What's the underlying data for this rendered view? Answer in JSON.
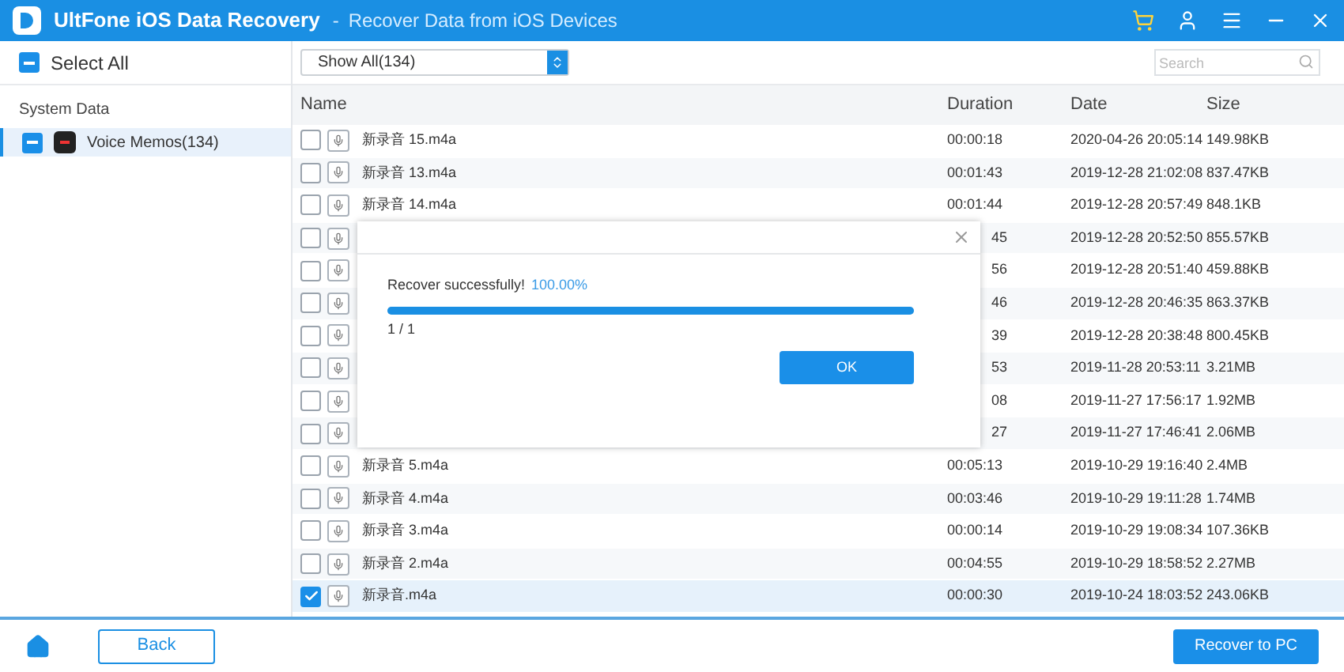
{
  "window": {
    "title": "UltFone iOS Data Recovery",
    "separator": "-",
    "subtitle": "Recover Data from iOS Devices"
  },
  "sidebar": {
    "select_all": {
      "label": "Select All",
      "partial": true
    },
    "section": "System Data",
    "items": [
      {
        "label": "Voice Memos(134)",
        "partial": true,
        "selected": true
      }
    ]
  },
  "toolbar": {
    "filter": "Show All(134)",
    "search": {
      "placeholder": "Search"
    }
  },
  "table": {
    "columns": [
      "Name",
      "Duration",
      "Date",
      "Size"
    ],
    "rows": [
      {
        "name": "新录音 15.m4a",
        "duration": "00:00:18",
        "date": "2020-04-26 20:05:14",
        "size": "149.98KB",
        "checked": false
      },
      {
        "name": "新录音 13.m4a",
        "duration": "00:01:43",
        "date": "2019-12-28 21:02:08",
        "size": "837.47KB",
        "checked": false
      },
      {
        "name": "新录音 14.m4a",
        "duration": "00:01:44",
        "date": "2019-12-28 20:57:49",
        "size": "848.1KB",
        "checked": false
      },
      {
        "duration": "45",
        "date": "2019-12-28 20:52:50",
        "size": "855.57KB",
        "checked": false
      },
      {
        "duration": "56",
        "date": "2019-12-28 20:51:40",
        "size": "459.88KB",
        "checked": false
      },
      {
        "duration": "46",
        "date": "2019-12-28 20:46:35",
        "size": "863.37KB",
        "checked": false
      },
      {
        "duration": "39",
        "date": "2019-12-28 20:38:48",
        "size": "800.45KB",
        "checked": false
      },
      {
        "duration": "53",
        "date": "2019-11-28 20:53:11",
        "size": "3.21MB",
        "checked": false
      },
      {
        "duration": "08",
        "date": "2019-11-27 17:56:17",
        "size": "1.92MB",
        "checked": false
      },
      {
        "duration": "27",
        "date": "2019-11-27 17:46:41",
        "size": "2.06MB",
        "checked": false
      },
      {
        "name": "新录音 5.m4a",
        "duration": "00:05:13",
        "date": "2019-10-29 19:16:40",
        "size": "2.4MB",
        "checked": false
      },
      {
        "name": "新录音 4.m4a",
        "duration": "00:03:46",
        "date": "2019-10-29 19:11:28",
        "size": "1.74MB",
        "checked": false
      },
      {
        "name": "新录音 3.m4a",
        "duration": "00:00:14",
        "date": "2019-10-29 19:08:34",
        "size": "107.36KB",
        "checked": false
      },
      {
        "name": "新录音 2.m4a",
        "duration": "00:04:55",
        "date": "2019-10-29 18:58:52",
        "size": "2.27MB",
        "checked": false
      },
      {
        "name": "新录音.m4a",
        "duration": "00:00:30",
        "date": "2019-10-24 18:03:52",
        "size": "243.06KB",
        "checked": true
      }
    ]
  },
  "dialog": {
    "message": "Recover successfully!",
    "percent": "100.00%",
    "level": 1.0,
    "count": "1 / 1",
    "button": "OK"
  },
  "footer": {
    "back": "Back",
    "recover": "Recover to PC"
  }
}
